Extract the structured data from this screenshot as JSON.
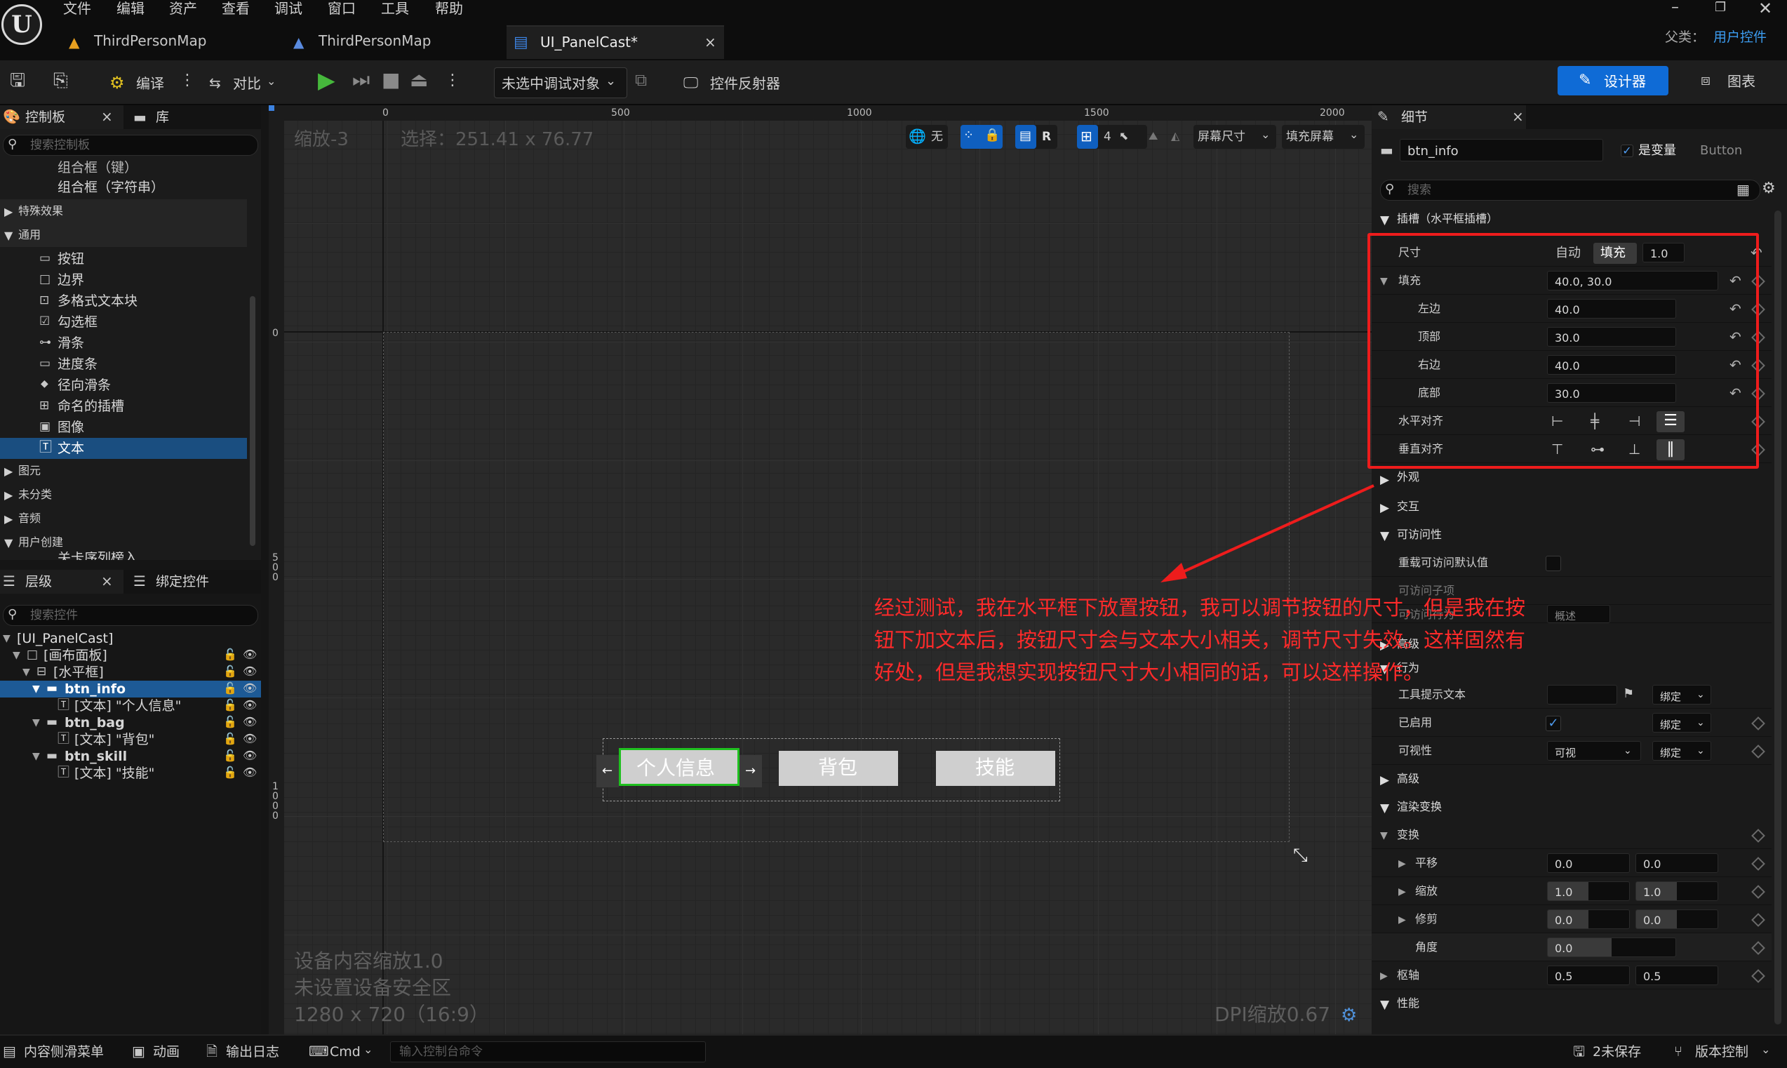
{
  "menu": [
    "文件",
    "编辑",
    "资产",
    "查看",
    "调试",
    "窗口",
    "工具",
    "帮助"
  ],
  "tabs": [
    {
      "label": "ThirdPersonMap"
    },
    {
      "label": "ThirdPersonMap"
    },
    {
      "label": "UI_PanelCast*"
    }
  ],
  "parent": {
    "label": "父类：",
    "value": "用户控件"
  },
  "toolbar": {
    "compile": "编译",
    "diff": "对比",
    "debug_select": "未选中调试对象",
    "reflector": "控件反射器",
    "designer": "设计器",
    "graph": "图表"
  },
  "palette": {
    "tab": "控制板",
    "library": "库",
    "search_placeholder": "搜索控制板",
    "top_items": [
      "组合框（键）",
      "组合框（字符串）"
    ],
    "cat_effects": "特殊效果",
    "cat_common": "通用",
    "items": [
      "按钮",
      "边界",
      "多格式文本块",
      "勾选框",
      "滑条",
      "进度条",
      "径向滑条",
      "命名的插槽",
      "图像",
      "文本"
    ],
    "cats_after": [
      "图元",
      "未分类",
      "音频",
      "用户创建"
    ],
    "cut_item": "关卡序列榜入"
  },
  "hierarchy": {
    "tab": "层级",
    "bind_tab": "绑定控件",
    "search_placeholder": "搜索控件",
    "rows": [
      "[UI_PanelCast]",
      "[画布面板]",
      "[水平框]",
      "btn_info",
      "[文本] \"个人信息\"",
      "btn_bag",
      "[文本] \"背包\"",
      "btn_skill",
      "[文本] \"技能\""
    ]
  },
  "viewport": {
    "zoom": "缩放-3",
    "selection": "选择：251.41 x 76.77",
    "ruler_top": [
      "0",
      "500",
      "1000",
      "1500",
      "2000"
    ],
    "ruler_left": [
      "0",
      "5",
      "0",
      "0",
      "1",
      "0",
      "0",
      "0"
    ],
    "none": "无",
    "r": "R",
    "grid": "4",
    "screen_size": "屏幕尺寸",
    "fill_screen": "填充屏幕",
    "btn_info": "个人信息",
    "btn_bag": "背包",
    "btn_skill": "技能",
    "arrow_left": "←",
    "arrow_right": "→",
    "info_lines": [
      "设备内容缩放1.0",
      "未设置设备安全区",
      "1280 x 720（16:9）"
    ],
    "dpi": "DPI缩放0.67"
  },
  "annotation": {
    "lines": [
      "经过测试，我在水平框下放置按钮，我可以调节按钮的尺寸，但是我在按",
      "钮下加文本后，按钮尺寸会与文本大小相关，调节尺寸失效。这样固然有",
      "好处，但是我想实现按钮尺寸大小相同的话，可以这样操作。"
    ],
    "color": "#ff2a2a"
  },
  "details": {
    "tab": "细节",
    "name": "btn_info",
    "is_var": "是变量",
    "type": "Button",
    "search_placeholder": "搜索",
    "slot_section": "插槽（水平框插槽）",
    "size_label": "尺寸",
    "size_auto": "自动",
    "size_fill": "填充",
    "size_value": "1.0",
    "padding_label": "填充",
    "padding_value": "40.0, 30.0",
    "left_label": "左边",
    "left_value": "40.0",
    "top_label": "顶部",
    "top_value": "30.0",
    "right_label": "右边",
    "right_value": "40.0",
    "bottom_label": "底部",
    "bottom_value": "30.0",
    "halign": "水平对齐",
    "valign": "垂直对齐",
    "appearance": "外观",
    "interaction": "交互",
    "accessibility": "可访问性",
    "override_access": "重载可访问默认值",
    "access_children": "可访问子项",
    "access_behavior": "可访问行为",
    "summary": "概述",
    "advanced": "高级",
    "behavior": "行为",
    "tooltip": "工具提示文本",
    "bind": "绑定",
    "enabled": "已启用",
    "visibility": "可视性",
    "visible": "可视",
    "advanced2": "高级",
    "render_transform": "渲染变换",
    "transform": "变换",
    "translation": "平移",
    "t1": "0.0",
    "t2": "0.0",
    "scale": "缩放",
    "s1": "1.0",
    "s2": "1.0",
    "shear": "修剪",
    "sh1": "0.0",
    "sh2": "0.0",
    "angle": "角度",
    "a1": "0.0",
    "pivot": "枢轴",
    "p1": "0.5",
    "p2": "0.5",
    "performance": "性能"
  },
  "status": {
    "drawer": "内容侧滑菜单",
    "anim": "动画",
    "log": "输出日志",
    "cmd": "Cmd",
    "cmd_placeholder": "输入控制台命令",
    "unsaved": "2未保存",
    "source": "版本控制"
  }
}
